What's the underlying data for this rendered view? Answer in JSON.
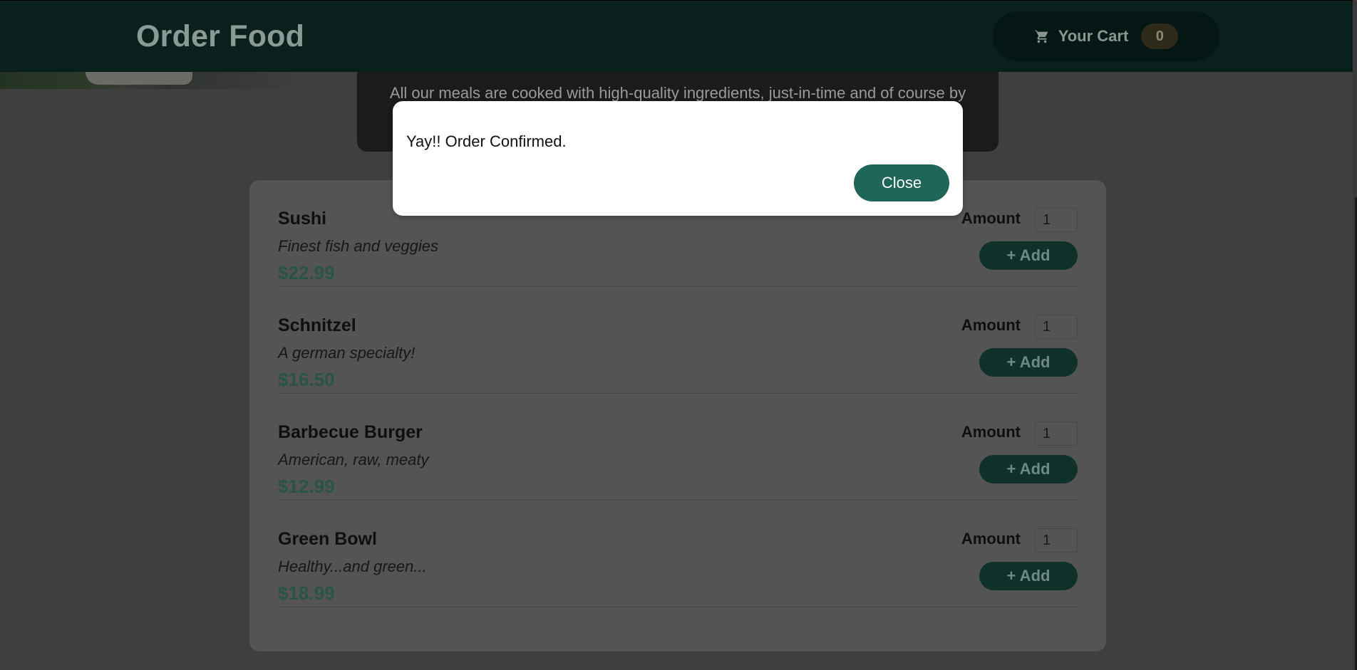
{
  "header": {
    "title": "Order Food",
    "cart": {
      "icon": "cart-icon",
      "label": "Your Cart",
      "count": "0"
    }
  },
  "summary": {
    "text": "All our meals are cooked with high-quality ingredients, just-in-time and of course by"
  },
  "meals": [
    {
      "name": "Sushi",
      "description": "Finest fish and veggies",
      "price": "$22.99",
      "amount_label": "Amount",
      "amount": "1",
      "add_label": "+ Add"
    },
    {
      "name": "Schnitzel",
      "description": "A german specialty!",
      "price": "$16.50",
      "amount_label": "Amount",
      "amount": "1",
      "add_label": "+ Add"
    },
    {
      "name": "Barbecue Burger",
      "description": "American, raw, meaty",
      "price": "$12.99",
      "amount_label": "Amount",
      "amount": "1",
      "add_label": "+ Add"
    },
    {
      "name": "Green Bowl",
      "description": "Healthy...and green...",
      "price": "$18.99",
      "amount_label": "Amount",
      "amount": "1",
      "add_label": "+ Add"
    }
  ],
  "modal": {
    "message": "Yay!! Order Confirmed.",
    "close_label": "Close"
  },
  "colors": {
    "brand_green": "#1f6558",
    "header_bg": "#0a201c",
    "overlay": "#3f3f3f"
  }
}
